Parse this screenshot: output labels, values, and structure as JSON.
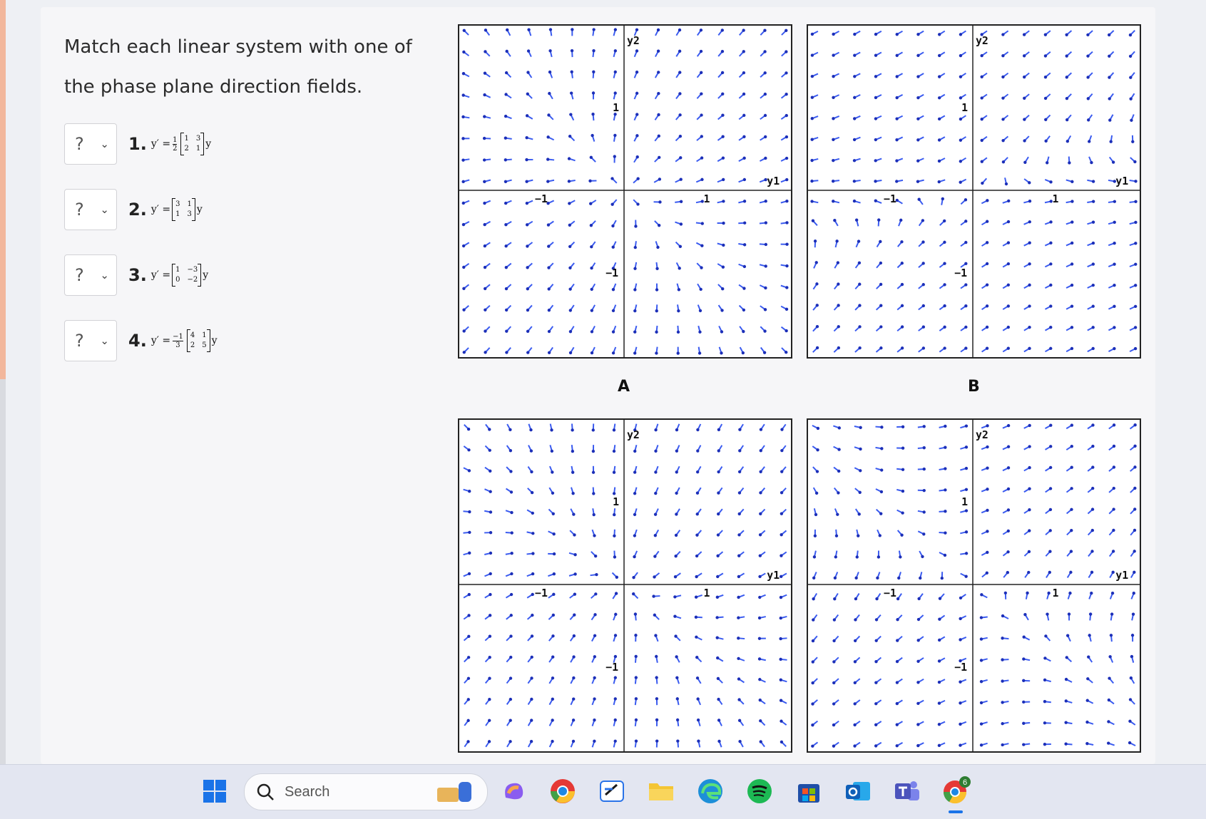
{
  "prompt": "Match each linear system with one of the phase plane direction fields.",
  "questions": [
    {
      "selected": "?",
      "number": "1.",
      "lhs": "y′ =",
      "scalar": {
        "num": "1",
        "den": "2"
      },
      "matrix": [
        "1",
        "3",
        "2",
        "1"
      ],
      "rhs": "y"
    },
    {
      "selected": "?",
      "number": "2.",
      "lhs": "y′ =",
      "scalar": null,
      "matrix": [
        "3",
        "1",
        "1",
        "3"
      ],
      "rhs": "y"
    },
    {
      "selected": "?",
      "number": "3.",
      "lhs": "y′ =",
      "scalar": null,
      "matrix": [
        "1",
        "−3",
        "0",
        "−2"
      ],
      "rhs": "y"
    },
    {
      "selected": "?",
      "number": "4.",
      "lhs": "y′ =",
      "scalar": {
        "num": "−1",
        "den": "3"
      },
      "matrix": [
        "4",
        "1",
        "2",
        "5"
      ],
      "rhs": "y"
    }
  ],
  "panels": [
    {
      "label": "A",
      "matrix": [
        3,
        1,
        1,
        3
      ],
      "scale": 1
    },
    {
      "label": "B",
      "matrix": [
        1,
        -3,
        0,
        -2
      ],
      "scale": 1
    },
    {
      "label": "",
      "matrix": [
        4,
        1,
        2,
        5
      ],
      "scale": -0.3333
    },
    {
      "label": "",
      "matrix": [
        1,
        3,
        2,
        1
      ],
      "scale": 0.5
    }
  ],
  "axes": {
    "x_label": "y1",
    "y_label": "y2",
    "pos_tick": "1",
    "neg_tick": "−1"
  },
  "colors": {
    "arrow": "#3a5bf0",
    "axis": "#222222"
  },
  "taskbar": {
    "search_placeholder": "Search",
    "badge": "6"
  }
}
